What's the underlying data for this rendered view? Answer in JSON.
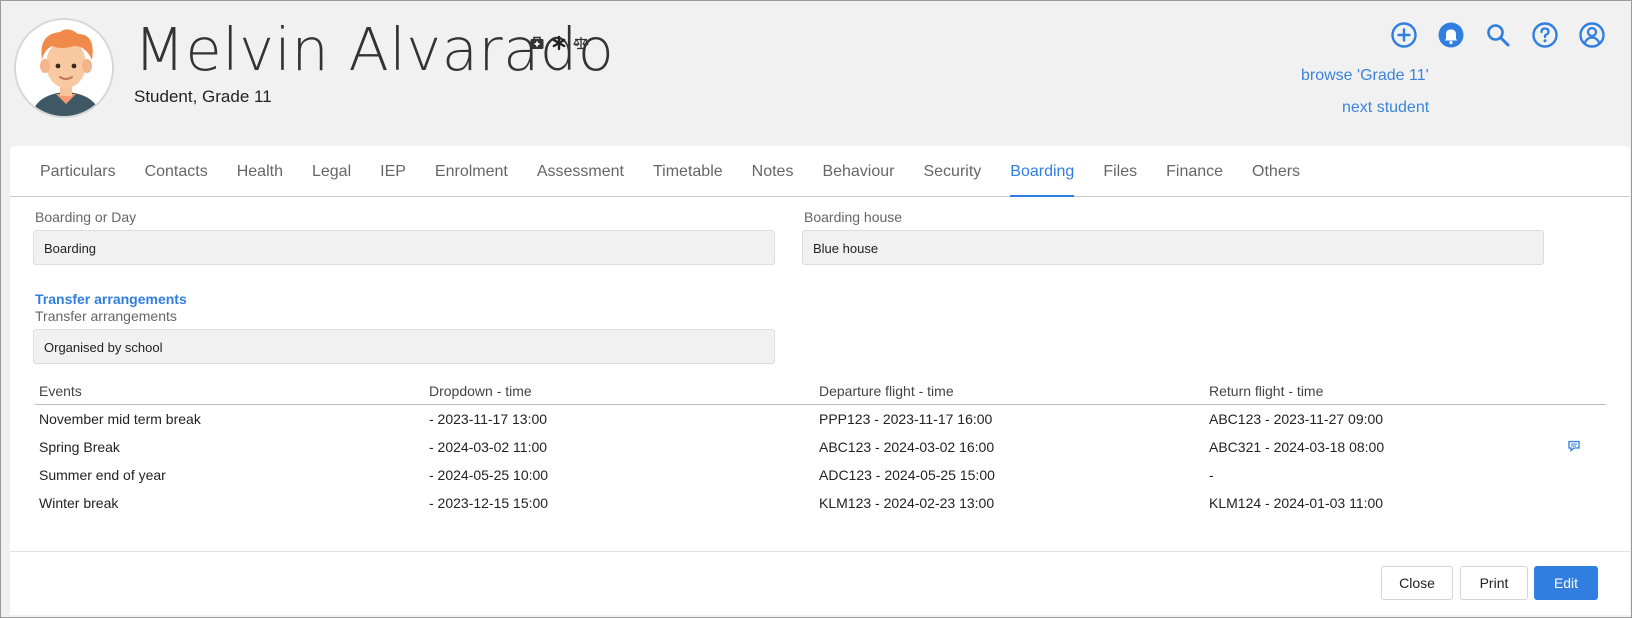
{
  "student": {
    "name": "Melvin Alvarado",
    "subtitle": "Student, Grade 11"
  },
  "header_links": {
    "browse": "browse 'Grade 11'",
    "next": "next student"
  },
  "tabs": [
    {
      "label": "Particulars"
    },
    {
      "label": "Contacts"
    },
    {
      "label": "Health"
    },
    {
      "label": "Legal"
    },
    {
      "label": "IEP"
    },
    {
      "label": "Enrolment"
    },
    {
      "label": "Assessment"
    },
    {
      "label": "Timetable"
    },
    {
      "label": "Notes"
    },
    {
      "label": "Behaviour"
    },
    {
      "label": "Security"
    },
    {
      "label": "Boarding",
      "active": true
    },
    {
      "label": "Files"
    },
    {
      "label": "Finance"
    },
    {
      "label": "Others"
    }
  ],
  "boarding": {
    "boarding_or_day_label": "Boarding or Day",
    "boarding_or_day_value": "Boarding",
    "boarding_house_label": "Boarding house",
    "boarding_house_value": "Blue house",
    "transfer_section": "Transfer arrangements",
    "transfer_label": "Transfer arrangements",
    "transfer_value": "Organised by school"
  },
  "events_table": {
    "headers": [
      "Events",
      "Dropdown - time",
      "Departure flight - time",
      "Return flight - time"
    ],
    "rows": [
      [
        "November mid term break",
        "- 2023-11-17 13:00",
        "PPP123 - 2023-11-17 16:00",
        "ABC123 - 2023-11-27 09:00"
      ],
      [
        "Spring Break",
        "- 2024-03-02 11:00",
        "ABC123 - 2024-03-02 16:00",
        "ABC321 - 2024-03-18 08:00"
      ],
      [
        "Summer end of year",
        "- 2024-05-25 10:00",
        "ADC123 - 2024-05-25 15:00",
        "-"
      ],
      [
        "Winter break",
        "- 2023-12-15 15:00",
        "KLM123 - 2024-02-23 13:00",
        "KLM124 - 2024-01-03 11:00"
      ]
    ]
  },
  "buttons": {
    "close": "Close",
    "print": "Print",
    "edit": "Edit"
  },
  "colors": {
    "accent": "#2f7ee0",
    "link": "#3a84d9",
    "page_bg": "#f1f1f2"
  },
  "icons": [
    "medical-kit-icon",
    "asterisk-icon",
    "scales-icon",
    "plus-circle-icon",
    "bell-icon",
    "search-icon",
    "help-icon",
    "user-circle-icon",
    "comment-icon"
  ]
}
